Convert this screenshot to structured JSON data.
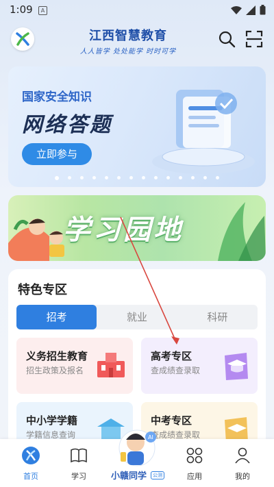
{
  "status_bar": {
    "time": "1:09",
    "notification_glyph": "A"
  },
  "header": {
    "title": "江西智慧教育",
    "slogan": "人人皆学 处处能学 时时可学"
  },
  "banner": {
    "subtitle": "国家安全知识",
    "title": "网络答题",
    "cta_label": "立即参与",
    "page_count": 14,
    "active_index": 0
  },
  "study_banner": {
    "title": "学习园地"
  },
  "featured": {
    "title": "特色专区",
    "tabs": [
      {
        "label": "招考",
        "active": true
      },
      {
        "label": "就业",
        "active": false
      },
      {
        "label": "科研",
        "active": false
      }
    ],
    "cards": [
      {
        "title": "义务招生教育",
        "subtitle": "招生政策及报名",
        "bg": "#fdeeee",
        "icon": "school-building-icon"
      },
      {
        "title": "高考专区",
        "subtitle": "查成绩查录取",
        "bg": "#f3eefd",
        "icon": "graduation-cap-icon"
      },
      {
        "title": "中小学学籍",
        "subtitle": "学籍信息查询",
        "bg": "#eaf4fd",
        "icon": "pavilion-icon"
      },
      {
        "title": "中考专区",
        "subtitle": "查成绩查录取",
        "bg": "#fdf6e6",
        "icon": "graduation-cap-icon"
      }
    ]
  },
  "tabbar": {
    "items": [
      {
        "label": "首页",
        "icon": "home-logo-icon",
        "active": true
      },
      {
        "label": "学习",
        "icon": "book-icon",
        "active": false
      },
      {
        "label": "应用",
        "icon": "apps-grid-icon",
        "active": false
      },
      {
        "label": "我的",
        "icon": "person-icon",
        "active": false
      }
    ],
    "mascot_label": "小赣同学",
    "mascot_tag": "AI",
    "mascot_badge": "公测"
  },
  "colors": {
    "accent": "#2f7fe0",
    "title_blue": "#1f4fa8",
    "annotation": "#d9473f"
  }
}
